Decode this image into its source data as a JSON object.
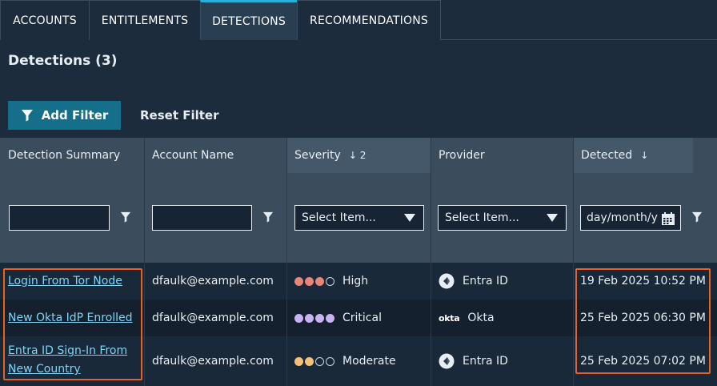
{
  "tabs": [
    "ACCOUNTS",
    "ENTITLEMENTS",
    "DETECTIONS",
    "RECOMMENDATIONS"
  ],
  "active_tab": "DETECTIONS",
  "page_title": "Detections (3)",
  "toolbar": {
    "add_filter_label": "Add Filter",
    "reset_filter_label": "Reset Filter"
  },
  "columns": {
    "summary": "Detection Summary",
    "account": "Account Name",
    "severity": "Severity",
    "severity_sort": "↓ 2",
    "provider": "Provider",
    "detected": "Detected",
    "detected_sort": "↓"
  },
  "filters": {
    "severity_placeholder": "Select Item...",
    "provider_placeholder": "Select Item...",
    "date_placeholder": "day/month/y"
  },
  "rows": [
    {
      "summary": "Login From Tor Node",
      "account": "dfaulk@example.com",
      "severity": "High",
      "severity_level": 3,
      "severity_color": "#e8857a",
      "provider": "Entra ID",
      "provider_icon": "entra-id-icon",
      "detected": "19 Feb 2025 10:52 PM"
    },
    {
      "summary": "New Okta IdP Enrolled",
      "account": "dfaulk@example.com",
      "severity": "Critical",
      "severity_level": 4,
      "severity_color": "#c9b2f2",
      "provider": "Okta",
      "provider_icon": "okta-logo",
      "provider_logo_text": "okta",
      "detected": "25 Feb 2025 06:30 PM"
    },
    {
      "summary": "Entra ID Sign-In From New Country",
      "summary_line1": "Entra ID Sign-In From",
      "summary_line2": "New Country",
      "account": "dfaulk@example.com",
      "severity": "Moderate",
      "severity_level": 2,
      "severity_color": "#f2c27a",
      "provider": "Entra ID",
      "provider_icon": "entra-id-icon",
      "detected": "25 Feb 2025 07:02 PM"
    }
  ],
  "colors": {
    "background": "#1c2c3d",
    "accent": "#2ab0d8",
    "button": "#156f8a",
    "link": "#7fd4f5",
    "highlight_box": "#e8621e"
  }
}
